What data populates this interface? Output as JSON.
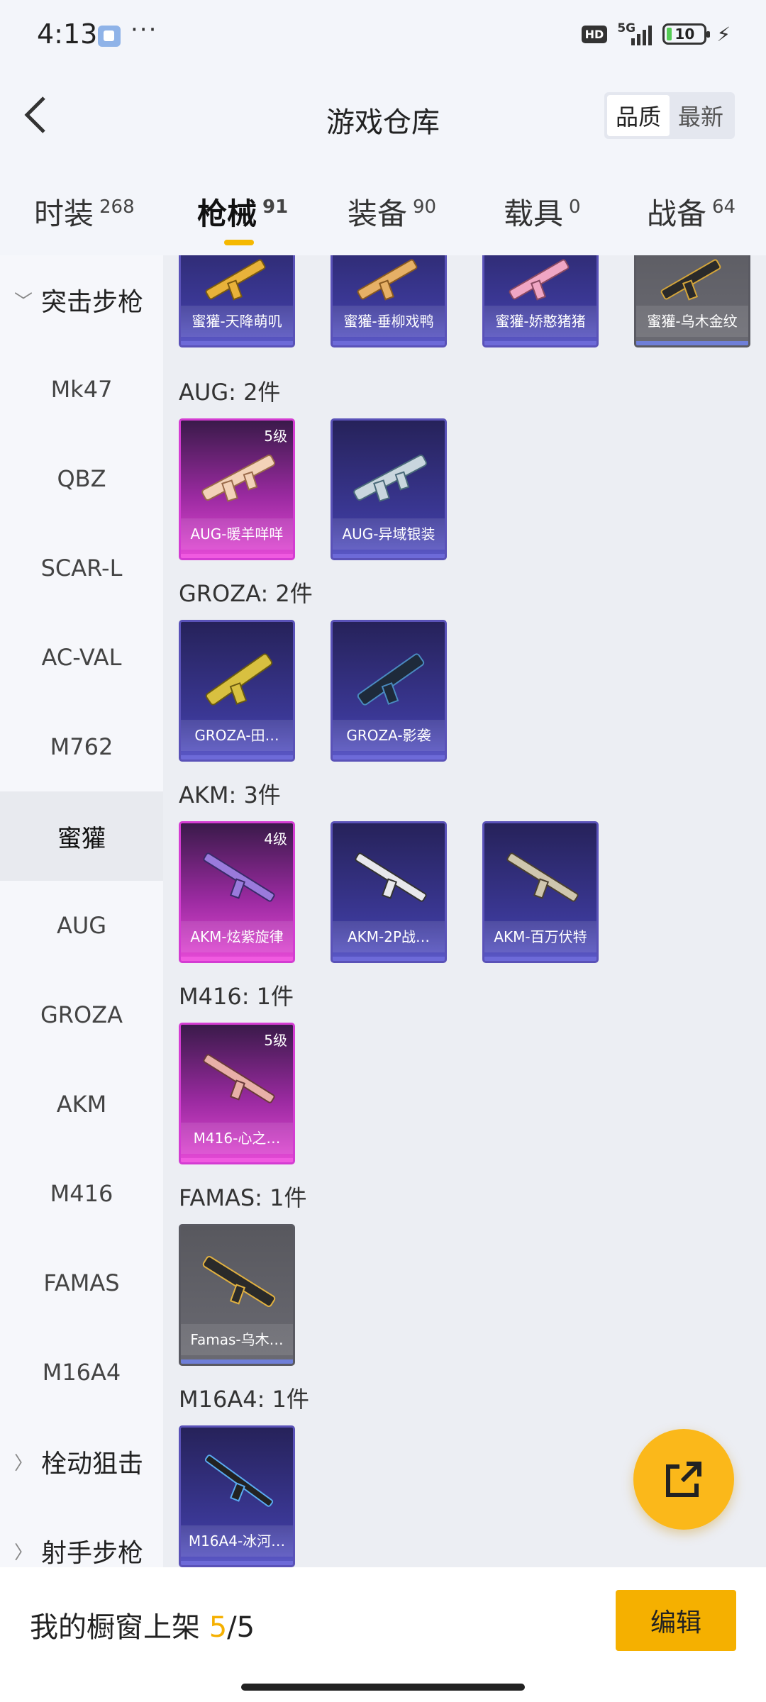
{
  "status": {
    "time": "4:13",
    "hd": "HD",
    "network": "5G",
    "battery": "10"
  },
  "header": {
    "title": "游戏仓库",
    "sort_quality": "品质",
    "sort_latest": "最新"
  },
  "tabs": [
    {
      "label": "时装",
      "count": "268"
    },
    {
      "label": "枪械",
      "count": "91",
      "active": true
    },
    {
      "label": "装备",
      "count": "90"
    },
    {
      "label": "载具",
      "count": "0"
    },
    {
      "label": "战备",
      "count": "64"
    }
  ],
  "sidebar": {
    "category_assault": "突击步枪",
    "items": [
      "Mk47",
      "QBZ",
      "SCAR-L",
      "AC-VAL",
      "M762",
      "蜜獾",
      "AUG",
      "GROZA",
      "AKM",
      "M416",
      "FAMAS",
      "M16A4"
    ],
    "category_bolt": "栓动狙击",
    "category_dmr": "射手步枪"
  },
  "content": {
    "honey_badger": [
      "蜜獾-天降萌叽",
      "蜜獾-垂柳戏鸭",
      "蜜獾-娇憨猪猪",
      "蜜獾-乌木金纹"
    ],
    "aug": {
      "heading": "AUG: 2件",
      "items": [
        {
          "name": "AUG-暖羊咩咩",
          "level": "5级"
        },
        {
          "name": "AUG-异域银装"
        }
      ]
    },
    "groza": {
      "heading": "GROZA: 2件",
      "items": [
        {
          "name": "GROZA-田…"
        },
        {
          "name": "GROZA-影袭"
        }
      ]
    },
    "akm": {
      "heading": "AKM: 3件",
      "items": [
        {
          "name": "AKM-炫紫旋律",
          "level": "4级"
        },
        {
          "name": "AKM-2P战…"
        },
        {
          "name": "AKM-百万伏特"
        }
      ]
    },
    "m416": {
      "heading": "M416: 1件",
      "items": [
        {
          "name": "M416-心之…",
          "level": "5级"
        }
      ]
    },
    "famas": {
      "heading": "FAMAS: 1件",
      "items": [
        {
          "name": "Famas-乌木…"
        }
      ]
    },
    "m16a4": {
      "heading": "M16A4: 1件",
      "items": [
        {
          "name": "M16A4-冰河…"
        }
      ]
    }
  },
  "bottom": {
    "label": "我的橱窗上架",
    "current": "5",
    "total": "/5",
    "edit": "编辑"
  },
  "colors": {
    "accent": "#f5b000",
    "purple_rarity": "#d43cd2",
    "blue_rarity": "#5a52b8",
    "grey_rarity": "#5a5a62"
  }
}
